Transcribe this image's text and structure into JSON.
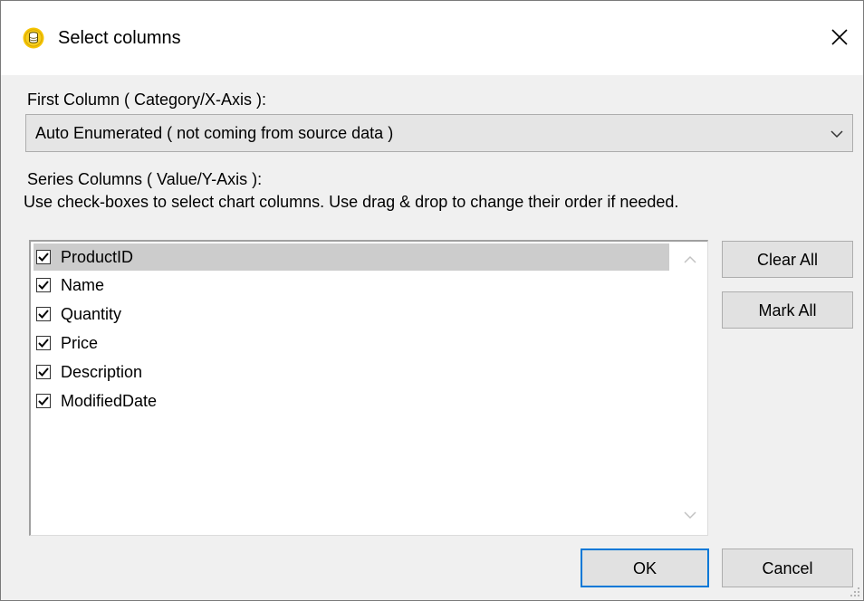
{
  "window": {
    "title": "Select columns",
    "app_icon": "database-icon",
    "close_icon": "close-icon"
  },
  "first_column": {
    "label": "First Column ( Category/X-Axis ):",
    "selected": "Auto Enumerated ( not coming from source data )"
  },
  "series": {
    "label": "Series Columns ( Value/Y-Axis ):",
    "hint": "Use check-boxes to select chart columns. Use drag & drop to change their order if needed.",
    "items": [
      {
        "label": "ProductID",
        "checked": true,
        "selected": true
      },
      {
        "label": "Name",
        "checked": true,
        "selected": false
      },
      {
        "label": "Quantity",
        "checked": true,
        "selected": false
      },
      {
        "label": "Price",
        "checked": true,
        "selected": false
      },
      {
        "label": "Description",
        "checked": true,
        "selected": false
      },
      {
        "label": "ModifiedDate",
        "checked": true,
        "selected": false
      }
    ]
  },
  "buttons": {
    "clear_all": "Clear All",
    "mark_all": "Mark All",
    "ok": "OK",
    "cancel": "Cancel"
  },
  "colors": {
    "dialog_bg": "#f0f0f0",
    "default_button_border": "#0078d7",
    "selected_row": "#cccccc",
    "icon_gold": "#f5c400"
  }
}
